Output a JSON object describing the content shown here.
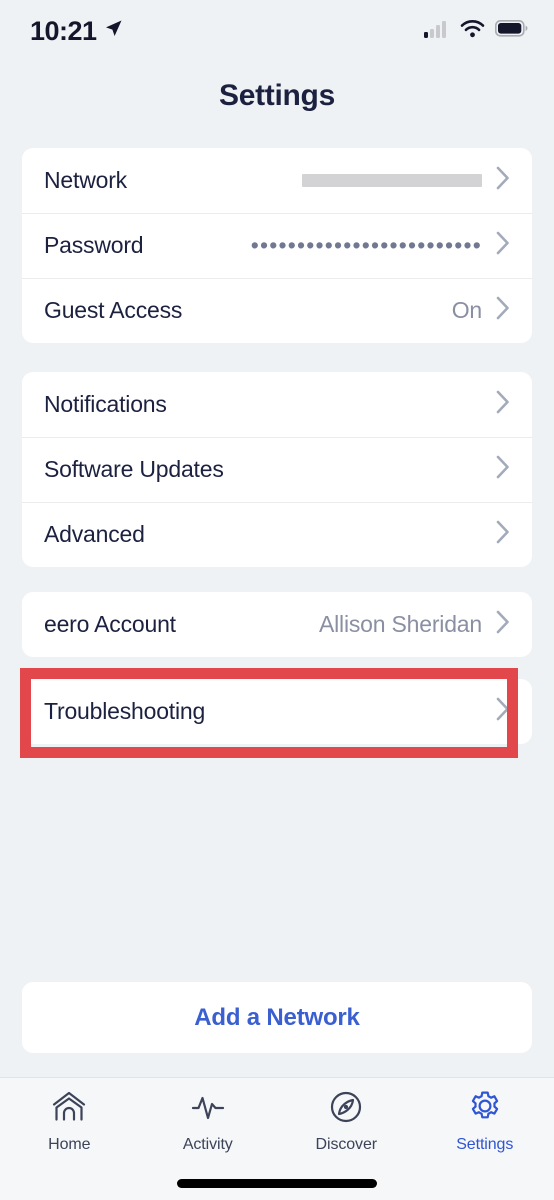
{
  "status_bar": {
    "time": "10:21",
    "location_icon": "location-arrow-icon",
    "cellular_icon": "cellular-signal-icon",
    "wifi_icon": "wifi-icon",
    "battery_icon": "battery-icon"
  },
  "header": {
    "title": "Settings"
  },
  "groups": [
    {
      "name": "network-group",
      "rows": [
        {
          "label": "Network",
          "value": "",
          "value_type": "redacted"
        },
        {
          "label": "Password",
          "value": "•••••••••••••••••••••••••",
          "value_type": "dots"
        },
        {
          "label": "Guest Access",
          "value": "On",
          "value_type": "text"
        }
      ]
    },
    {
      "name": "system-group",
      "rows": [
        {
          "label": "Notifications",
          "value": "",
          "value_type": "none"
        },
        {
          "label": "Software Updates",
          "value": "",
          "value_type": "none"
        },
        {
          "label": "Advanced",
          "value": "",
          "value_type": "none"
        }
      ]
    },
    {
      "name": "account-group",
      "rows": [
        {
          "label": "eero Account",
          "value": "Allison Sheridan",
          "value_type": "text"
        }
      ]
    },
    {
      "name": "troubleshooting-group",
      "rows": [
        {
          "label": "Troubleshooting",
          "value": "",
          "value_type": "none"
        }
      ]
    }
  ],
  "annotation": {
    "target": "Troubleshooting",
    "color": "#e2484b"
  },
  "add_network": {
    "label": "Add a Network",
    "color": "#3a5fd0"
  },
  "tab_bar": {
    "active": "Settings",
    "active_color": "#2f55d4",
    "inactive_color": "#3d4358",
    "items": [
      {
        "label": "Home",
        "icon": "home-icon"
      },
      {
        "label": "Activity",
        "icon": "activity-pulse-icon"
      },
      {
        "label": "Discover",
        "icon": "discover-compass-icon"
      },
      {
        "label": "Settings",
        "icon": "gear-icon"
      }
    ]
  },
  "colors": {
    "background": "#eff2f4",
    "card": "#ffffff",
    "primary_text": "#1c2140",
    "secondary_text": "#8a8fa3",
    "chevron": "#a3abbb",
    "divider": "#ececef"
  }
}
